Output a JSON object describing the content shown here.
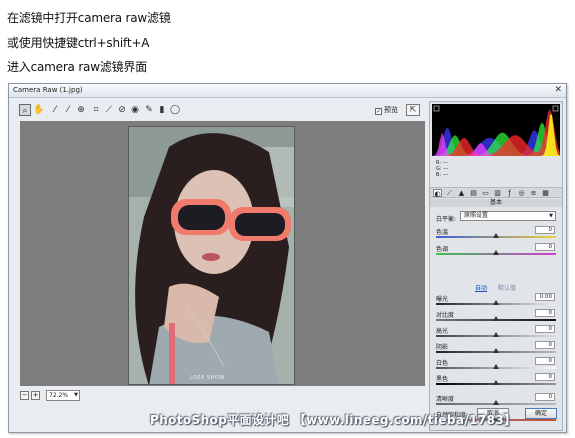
{
  "intro": {
    "line1": "在滤镜中打开camera raw滤镜",
    "line2": "或使用快捷键ctrl+shift+A",
    "line3": "进入camera raw滤镜界面"
  },
  "window": {
    "title": "Camera Raw (1.jpg)",
    "close_glyph": "✕"
  },
  "toolbar": {
    "tools": [
      "zoom-tool",
      "hand-tool",
      "white-balance-tool",
      "color-sampler-tool",
      "targeted-adjustment-tool",
      "crop-tool",
      "straighten-tool",
      "spot-removal-tool",
      "red-eye-tool",
      "adjustment-brush",
      "graduated-filter",
      "radial-filter"
    ],
    "preview_label": "预览",
    "preview_checked": true,
    "fullscreen_glyph": "⇱"
  },
  "canvas": {
    "photo_caption": "LOSE SHOW",
    "photo_colors": {
      "hair": "#2a1f1e",
      "skin": "#dcc1b4",
      "glasses": "#f07a6c",
      "sweater": "#9eaab0",
      "straw": "#e06a75",
      "background": "#a6b1ab"
    }
  },
  "statusbar": {
    "zoom_minus": "−",
    "zoom_plus": "+",
    "zoom_value": "72.2%"
  },
  "histogram": {
    "colors": [
      "#ff0000",
      "#00ff00",
      "#0000ff",
      "#ffff00",
      "#00ffff",
      "#ff00ff",
      "#ffffff"
    ]
  },
  "rgb": {
    "r_label": "R:",
    "g_label": "G:",
    "b_label": "B:",
    "r": "---",
    "g": "---",
    "b": "---"
  },
  "panel": {
    "tabs": [
      "basic",
      "tone-curve",
      "detail",
      "hsl",
      "split-toning",
      "lens",
      "fx",
      "camera-calibration",
      "presets",
      "snapshots"
    ],
    "section_title": "基本",
    "white_balance_label": "白平衡:",
    "white_balance_value": "原照设置",
    "auto_label": "自动",
    "default_label": "默认值",
    "sliders": [
      {
        "key": "temperature",
        "label": "色温",
        "value": "0",
        "position": 0.5
      },
      {
        "key": "tint",
        "label": "色调",
        "value": "0",
        "position": 0.5
      },
      {
        "key": "exposure",
        "label": "曝光",
        "value": "0.00",
        "position": 0.5
      },
      {
        "key": "contrast",
        "label": "对比度",
        "value": "0",
        "position": 0.5
      },
      {
        "key": "highlights",
        "label": "高光",
        "value": "0",
        "position": 0.5
      },
      {
        "key": "shadows",
        "label": "阴影",
        "value": "0",
        "position": 0.5
      },
      {
        "key": "whites",
        "label": "白色",
        "value": "0",
        "position": 0.5
      },
      {
        "key": "blacks",
        "label": "黑色",
        "value": "0",
        "position": 0.5
      },
      {
        "key": "clarity",
        "label": "清晰度",
        "value": "0",
        "position": 0.5
      },
      {
        "key": "vibrance",
        "label": "自然饱和度",
        "value": "0",
        "position": 0.5
      }
    ]
  },
  "footer": {
    "open_label": "取消",
    "done_label": "确定"
  },
  "watermark": "PhotoShop平面设计吧 【www.lineeg.com/tieba/1783】"
}
